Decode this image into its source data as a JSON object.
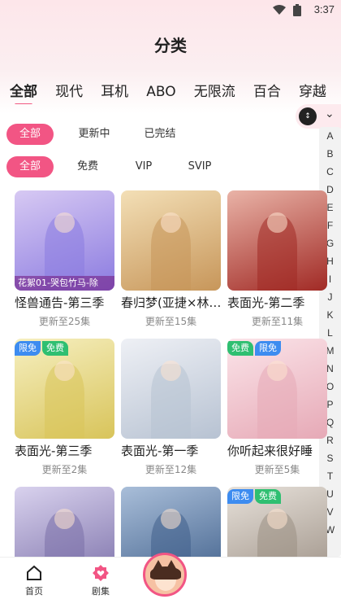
{
  "status": {
    "time": "3:37"
  },
  "header": {
    "title": "分类"
  },
  "category_tabs": [
    {
      "label": "全部",
      "active": true
    },
    {
      "label": "现代"
    },
    {
      "label": "耳机"
    },
    {
      "label": "ABO"
    },
    {
      "label": "无限流"
    },
    {
      "label": "百合"
    },
    {
      "label": "穿越"
    }
  ],
  "filters": {
    "status": [
      {
        "label": "全部",
        "active": true
      },
      {
        "label": "更新中"
      },
      {
        "label": "已完结"
      }
    ],
    "price": [
      {
        "label": "全部",
        "active": true
      },
      {
        "label": "免费"
      },
      {
        "label": "VIP"
      },
      {
        "label": "SVIP"
      }
    ]
  },
  "alphabet": [
    "A",
    "B",
    "C",
    "D",
    "E",
    "F",
    "G",
    "H",
    "I",
    "J",
    "K",
    "L",
    "M",
    "N",
    "O",
    "P",
    "Q",
    "R",
    "S",
    "T",
    "U",
    "V",
    "W"
  ],
  "cards": [
    {
      "title": "怪兽通告-第三季",
      "sub": "更新至25集",
      "caption": "花絮01-哭包竹马-除",
      "tags": [],
      "colors": [
        "#8b7be0",
        "#d7c9f3"
      ]
    },
    {
      "title": "春归梦(亚捷×林…",
      "sub": "更新至15集",
      "caption": "",
      "tags": [],
      "colors": [
        "#c7965a",
        "#f3dfb6"
      ]
    },
    {
      "title": "表面光-第二季",
      "sub": "更新至11集",
      "caption": "",
      "tags": [],
      "colors": [
        "#a12a25",
        "#e9b3a7"
      ]
    },
    {
      "title": "表面光-第三季",
      "sub": "更新至2集",
      "caption": "",
      "tags": [
        "限免",
        "免费"
      ],
      "colors": [
        "#d8c45a",
        "#f6efc0"
      ]
    },
    {
      "title": "表面光-第一季",
      "sub": "更新至12集",
      "caption": "",
      "tags": [],
      "colors": [
        "#b7c2d2",
        "#eef0f5"
      ]
    },
    {
      "title": "你听起来很好睡",
      "sub": "更新至5集",
      "caption": "",
      "tags": [
        "免费",
        "限免"
      ],
      "colors": [
        "#e6a9b6",
        "#fbe4e9"
      ]
    },
    {
      "title": "",
      "sub": "",
      "caption": "",
      "tags": [],
      "colors": [
        "#7a6fa8",
        "#d9d2ee"
      ]
    },
    {
      "title": "",
      "sub": "",
      "caption": "",
      "tags": [],
      "colors": [
        "#3f5f8a",
        "#a9bed9"
      ]
    },
    {
      "title": "",
      "sub": "",
      "caption": "",
      "tags": [
        "限免",
        "免费"
      ],
      "colors": [
        "#9b8f84",
        "#e7e1da"
      ]
    }
  ],
  "bottom_nav": {
    "home": "首页",
    "drama": "剧集"
  },
  "colors": {
    "accent": "#f25584",
    "tag_blue": "#3d8cf0",
    "tag_green": "#2fbf71"
  }
}
